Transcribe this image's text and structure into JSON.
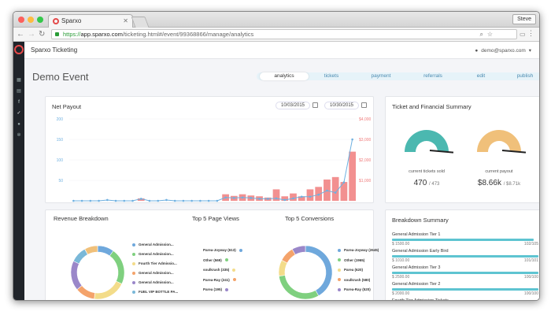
{
  "browser": {
    "tab_title": "Sparxo",
    "user": "Steve",
    "url_scheme": "https://",
    "url_host": "app.sparxo.com",
    "url_path": "/ticketing.html#/event/99368866/manage/analytics"
  },
  "app": {
    "brand": "Sparxo Ticketing",
    "account": "demo@sparxo.com"
  },
  "page": {
    "title": "Demo Event",
    "tabs": [
      "analytics",
      "tickets",
      "payment",
      "referrals",
      "edit",
      "publish"
    ],
    "active_tab": "analytics"
  },
  "net_payout": {
    "title": "Net Payout",
    "date_from": "10/03/2015",
    "date_to": "10/30/2015",
    "chart_data": {
      "type": "bar",
      "title": "Net Payout",
      "y_ticks_left": [
        "200",
        "150",
        "100",
        "50"
      ],
      "y_ticks_right": [
        "$4,000",
        "$3,000",
        "$2,000",
        "$1,000"
      ],
      "ylim_left": [
        0,
        200
      ],
      "ylim_right": [
        0,
        4000
      ],
      "series": [
        {
          "values": [
            0,
            0,
            0,
            0,
            0,
            0,
            0,
            0,
            120,
            0,
            0,
            0,
            0,
            0,
            0,
            0,
            0,
            0,
            320,
            240,
            320,
            260,
            220,
            160,
            560,
            220,
            360,
            220,
            560,
            680,
            1040,
            1160,
            920,
            2400
          ]
        },
        {
          "values": [
            0,
            0,
            0,
            0,
            2,
            0,
            0,
            0,
            5,
            0,
            0,
            2,
            0,
            0,
            0,
            0,
            0,
            0,
            8,
            7,
            8,
            7,
            5,
            5,
            6,
            2,
            6,
            10,
            10,
            15,
            25,
            20,
            45,
            150
          ]
        }
      ],
      "colors": {
        "bars": "#f07c7c",
        "line": "#6fb0e0"
      }
    }
  },
  "ticket_summary": {
    "title": "Ticket and Financial Summary",
    "gauges": [
      {
        "label": "current tickets sold",
        "value": "470",
        "total": "/ 473",
        "fraction": 0.99,
        "color": "#4bb8b0"
      },
      {
        "label": "current payout",
        "value": "$8.66",
        "value_suffix": "k",
        "total": "/ $8.71k",
        "fraction": 0.99,
        "color": "#f0c07a"
      }
    ]
  },
  "breakdown": {
    "revenue": {
      "title": "Revenue Breakdown",
      "items": [
        {
          "label": "General Admission...",
          "color": "#6fa8dc",
          "value": 10
        },
        {
          "label": "General Admission...",
          "color": "#7fd07f",
          "value": 22
        },
        {
          "label": "Fourth Tier Admissio...",
          "color": "#f3dc8a",
          "value": 20
        },
        {
          "label": "General Admission...",
          "color": "#f4a36b",
          "value": 12
        },
        {
          "label": "General Admission...",
          "color": "#9a87c9",
          "value": 18
        },
        {
          "label": "FUEL VIP BOTTLE PA...",
          "color": "#7ab8d8",
          "value": 10
        },
        {
          "label": "FIRE VIP BOTTLE PA...",
          "color": "#f0c07a",
          "value": 8
        }
      ]
    },
    "page_views": {
      "title": "Top 5 Page Views",
      "items": [
        {
          "label": "Parea-Joyway (613)",
          "color": "#6fa8dc"
        },
        {
          "label": "Other (569)",
          "color": "#7fd07f"
        },
        {
          "label": "soulkrush (335)",
          "color": "#f3dc8a"
        },
        {
          "label": "Parea-Ray (241)",
          "color": "#f4a36b"
        },
        {
          "label": "Parea (195)",
          "color": "#9a87c9"
        }
      ]
    },
    "conversions": {
      "title": "Top 5 Conversions",
      "items": [
        {
          "label": "Parea-Joyway (2645)",
          "color": "#6fa8dc",
          "value": 2645
        },
        {
          "label": "Other (1965)",
          "color": "#7fd07f",
          "value": 1965
        },
        {
          "label": "Parea (620)",
          "color": "#f3dc8a",
          "value": 620
        },
        {
          "label": "soulkrush (580)",
          "color": "#f4a36b",
          "value": 580
        },
        {
          "label": "Parea-Ray (520)",
          "color": "#9a87c9",
          "value": 520
        }
      ]
    }
  },
  "breakdown_summary": {
    "title": "Breakdown Summary",
    "rows": [
      {
        "name": "General Admission Tier 1",
        "amount": "$ 1500.00",
        "count": "102/105",
        "fraction": 0.97
      },
      {
        "name": "General Admission Early Bird",
        "amount": "$ 1010.00",
        "count": "101/101",
        "fraction": 1.0
      },
      {
        "name": "General Admission Tier 3",
        "amount": "$ 2500.00",
        "count": "100/100",
        "fraction": 1.0
      },
      {
        "name": "General Admission Tier 2",
        "amount": "$ 2000.00",
        "count": "100/100",
        "fraction": 1.0
      },
      {
        "name": "Fourth Tier Admission Tickets",
        "amount": "$ 1000.00",
        "count": "...",
        "fraction": 1.0
      }
    ]
  }
}
